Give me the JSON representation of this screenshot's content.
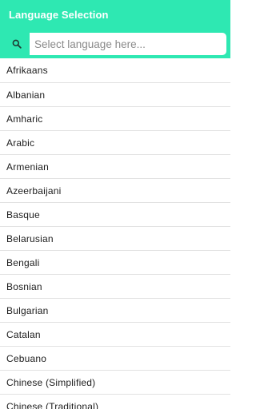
{
  "header": {
    "title": "Language Selection"
  },
  "search": {
    "placeholder": "Select language here...",
    "value": "",
    "icon": "search-icon"
  },
  "colors": {
    "accent": "#2ee8b2"
  },
  "languages": [
    {
      "label": "Afrikaans"
    },
    {
      "label": "Albanian"
    },
    {
      "label": "Amharic"
    },
    {
      "label": "Arabic"
    },
    {
      "label": "Armenian"
    },
    {
      "label": "Azeerbaijani"
    },
    {
      "label": "Basque"
    },
    {
      "label": "Belarusian"
    },
    {
      "label": "Bengali"
    },
    {
      "label": "Bosnian"
    },
    {
      "label": "Bulgarian"
    },
    {
      "label": "Catalan"
    },
    {
      "label": "Cebuano"
    },
    {
      "label": "Chinese (Simplified)"
    },
    {
      "label": "Chinese (Traditional)"
    }
  ]
}
